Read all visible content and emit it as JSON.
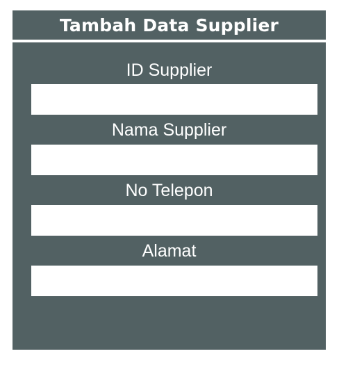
{
  "form": {
    "title": "Tambah Data Supplier",
    "fields": [
      {
        "label": "ID Supplier",
        "value": ""
      },
      {
        "label": "Nama Supplier",
        "value": ""
      },
      {
        "label": "No Telepon",
        "value": ""
      },
      {
        "label": "Alamat",
        "value": ""
      }
    ]
  },
  "colors": {
    "panel": "#526163",
    "text": "#ffffff",
    "input_bg": "#ffffff"
  }
}
